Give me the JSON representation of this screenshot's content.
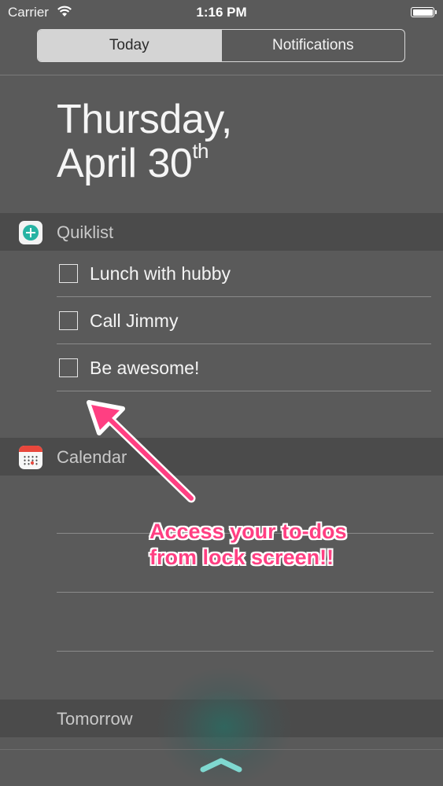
{
  "status_bar": {
    "carrier": "Carrier",
    "time": "1:16 PM"
  },
  "segmented_control": {
    "tabs": [
      {
        "label": "Today",
        "selected": true
      },
      {
        "label": "Notifications",
        "selected": false
      }
    ]
  },
  "date": {
    "weekday": "Thursday,",
    "month_day": "April 30",
    "ordinal_suffix": "th"
  },
  "quiklist": {
    "title": "Quiklist",
    "icon": "quiklist-plus-icon",
    "items": [
      {
        "label": "Lunch with hubby",
        "checked": false
      },
      {
        "label": "Call Jimmy",
        "checked": false
      },
      {
        "label": "Be awesome!",
        "checked": false
      }
    ]
  },
  "calendar": {
    "title": "Calendar",
    "icon": "calendar-icon"
  },
  "tomorrow": {
    "title": "Tomorrow"
  },
  "annotation": {
    "line1": "Access your to-dos",
    "line2": "from lock screen!!",
    "color": "#ff3f82"
  },
  "colors": {
    "background": "#5a5a5a",
    "section_header": "#4b4b4b",
    "quiklist_accent": "#27b3a3",
    "calendar_accent": "#e8473c"
  }
}
